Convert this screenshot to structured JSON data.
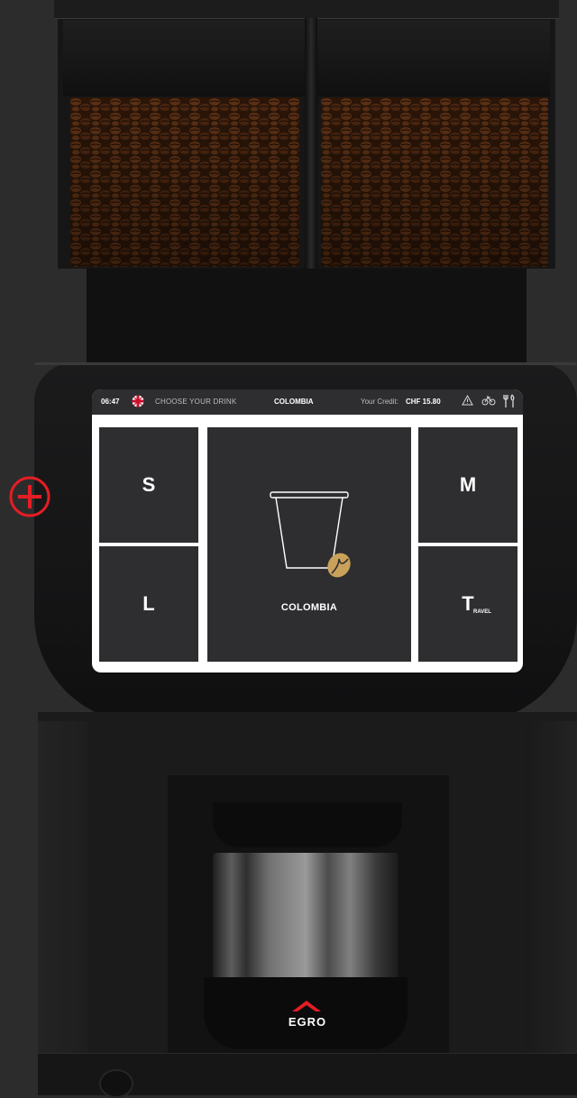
{
  "statusbar": {
    "time": "06:47",
    "choose_label": "CHOOSE YOUR DRINK",
    "product": "COLOMBIA",
    "credit_label": "Your Credit:",
    "credit_value": "CHF 15.80",
    "icons": [
      "uk-flag-icon",
      "warning-icon",
      "bicycle-icon",
      "tools-icon"
    ]
  },
  "tiles": {
    "s": "S",
    "l": "L",
    "m": "M",
    "t": "T",
    "t_sub": "RAVEL",
    "main_product": "COLOMBIA"
  },
  "brand": {
    "name": "EGRO",
    "accent": "#e31e24"
  },
  "colors": {
    "tile": "#2e2e30",
    "screen_bg": "#ffffff",
    "machine": "#1b1b1c",
    "bean_gold": "#c9a15a",
    "marker_red": "#e31e24"
  }
}
